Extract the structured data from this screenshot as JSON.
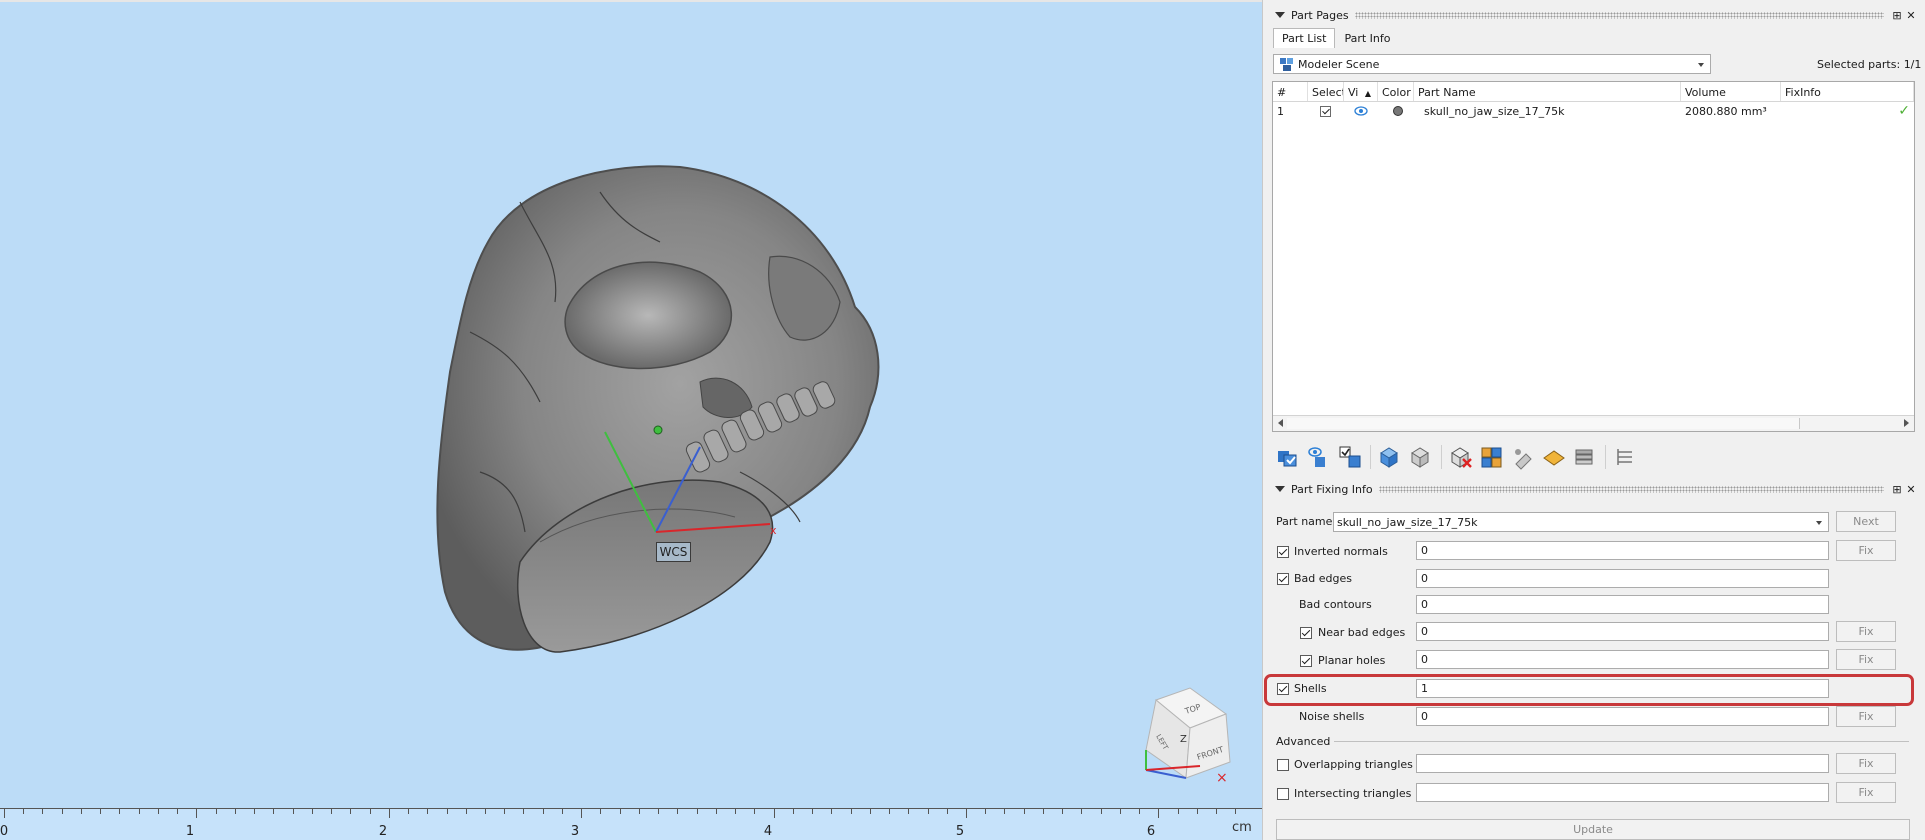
{
  "viewport": {
    "wcs_label": "WCS",
    "ruler": {
      "labels": [
        "0",
        "1",
        "2",
        "3",
        "4",
        "5",
        "6"
      ],
      "unit": "cm"
    },
    "viewcube": {
      "top": "TOP",
      "front": "FRONT",
      "left": "LEFT",
      "axis": "Z"
    },
    "colors": {
      "background": "#bcdcf7",
      "x_axis": "#d9262b",
      "y_axis": "#3fbf3f",
      "z_axis": "#3a5fd0"
    }
  },
  "part_pages": {
    "title": "Part Pages",
    "tabs": [
      "Part List",
      "Part Info"
    ],
    "active_tab": "Part List",
    "scene_select": "Modeler Scene",
    "selected_parts_label": "Selected parts:",
    "selected_parts_value": "1/1",
    "table": {
      "headers": [
        "#",
        "Select",
        "Vi",
        "Color",
        "Part Name",
        "Volume",
        "FixInfo"
      ],
      "rows": [
        {
          "num": "1",
          "selected": true,
          "visible": true,
          "color": "#777777",
          "name": "skull_no_jaw_size_17_75k",
          "volume": "2080.880 mm³",
          "fix_ok": true
        }
      ]
    },
    "toolbar_icons": [
      "select-all-icon",
      "toggle-visibility-icon",
      "invert-selection-icon",
      "merge-parts-icon",
      "split-parts-icon",
      "delete-part-icon",
      "color-parts-icon",
      "pin-part-icon",
      "label-part-icon",
      "stack-parts-icon",
      "list-settings-icon"
    ]
  },
  "part_fixing": {
    "title": "Part Fixing Info",
    "part_name_label": "Part name",
    "part_name_value": "skull_no_jaw_size_17_75k",
    "next_label": "Next",
    "fix_label": "Fix",
    "update_label": "Update",
    "advanced_label": "Advanced",
    "rows": {
      "inverted_normals": {
        "label": "Inverted normals",
        "value": "0",
        "checked": true
      },
      "bad_edges": {
        "label": "Bad edges",
        "value": "0",
        "checked": true
      },
      "bad_contours": {
        "label": "Bad contours",
        "value": "0"
      },
      "near_bad_edges": {
        "label": "Near bad edges",
        "value": "0",
        "checked": true
      },
      "planar_holes": {
        "label": "Planar holes",
        "value": "0",
        "checked": true
      },
      "shells": {
        "label": "Shells",
        "value": "1",
        "checked": true
      },
      "noise_shells": {
        "label": "Noise shells",
        "value": "0"
      },
      "overlapping_triangles": {
        "label": "Overlapping triangles",
        "value": "",
        "checked": false
      },
      "intersecting_triangles": {
        "label": "Intersecting triangles",
        "value": "",
        "checked": false
      }
    },
    "highlight_color": "#c8383a"
  }
}
